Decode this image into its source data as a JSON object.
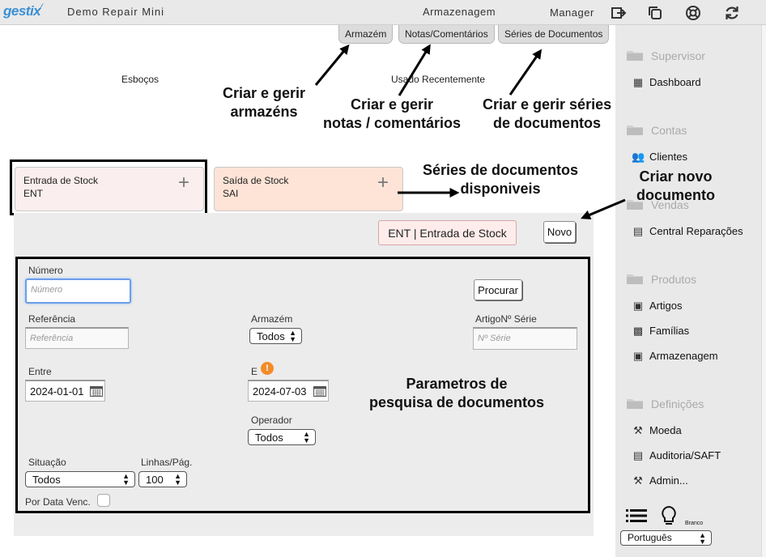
{
  "topbar": {
    "logo": "gestix",
    "app_name": "Demo Repair Mini",
    "section": "Armazenagem",
    "user": "Manager",
    "icons": [
      "logout-icon",
      "windows-icon",
      "help-icon",
      "refresh-icon"
    ]
  },
  "tabs": [
    {
      "label": "Armazém"
    },
    {
      "label": "Notas/Comentários"
    },
    {
      "label": "Séries de Documentos"
    }
  ],
  "labels": {
    "drafts": "Esboços",
    "recent": "Usado Recentemente"
  },
  "annotations": {
    "warehouses": [
      "Criar e gerir",
      "armazéns"
    ],
    "notes": [
      "Criar e gerir",
      "notas / comentários"
    ],
    "series": [
      "Criar e gerir séries",
      "de documentos"
    ],
    "available_series": [
      "Séries de documentos",
      "disponiveis"
    ],
    "new_document": [
      "Criar novo",
      "documento"
    ],
    "search_params": [
      "Parametros de",
      "pesquisa de documentos"
    ]
  },
  "series_tiles": [
    {
      "name": "Entrada de Stock",
      "code": "ENT",
      "bg": "#fbeeee"
    },
    {
      "name": "Saída de Stock",
      "code": "SAI",
      "bg": "#fde4d6"
    }
  ],
  "current_series": "ENT | Entrada de Stock",
  "new_button": "Novo",
  "search": {
    "number_label": "Número",
    "number_placeholder": "Número",
    "search_button": "Procurar",
    "reference_label": "Referência",
    "reference_placeholder": "Referência",
    "warehouse_label": "Armazém",
    "warehouse_value": "Todos",
    "serial_label": "ArtigoNº Série",
    "serial_placeholder": "Nº Série",
    "from_label": "Entre",
    "from_value": "2024-01-01",
    "to_label": "E",
    "to_value": "2024-07-03",
    "operator_label": "Operador",
    "operator_value": "Todos",
    "status_label": "Situação",
    "status_value": "Todos",
    "lines_label": "Linhas/Pág.",
    "lines_value": "100",
    "due_date_label": "Por Data Venc."
  },
  "sidebar": {
    "groups": [
      {
        "title": "Supervisor",
        "items": [
          {
            "label": "Dashboard",
            "icon": "dashboard-icon"
          }
        ]
      },
      {
        "title": "Contas",
        "items": [
          {
            "label": "Clientes",
            "icon": "clients-icon"
          }
        ]
      },
      {
        "title": "Vendas",
        "items": [
          {
            "label": "Central Reparações",
            "icon": "repairs-icon"
          }
        ]
      },
      {
        "title": "Produtos",
        "items": [
          {
            "label": "Artigos",
            "icon": "articles-icon"
          },
          {
            "label": "Famílias",
            "icon": "families-icon"
          },
          {
            "label": "Armazenagem",
            "icon": "warehouse-icon"
          }
        ]
      },
      {
        "title": "Definições",
        "items": [
          {
            "label": "Moeda",
            "icon": "currency-icon"
          },
          {
            "label": "Auditoria/SAFT",
            "icon": "audit-icon"
          },
          {
            "label": "Admin...",
            "icon": "admin-icon"
          }
        ]
      }
    ],
    "theme_label": "Branco",
    "language": "Português"
  },
  "colors": {
    "accent": "#3a8fd6",
    "annotation_border": "#000000",
    "warning": "#f28c28"
  }
}
